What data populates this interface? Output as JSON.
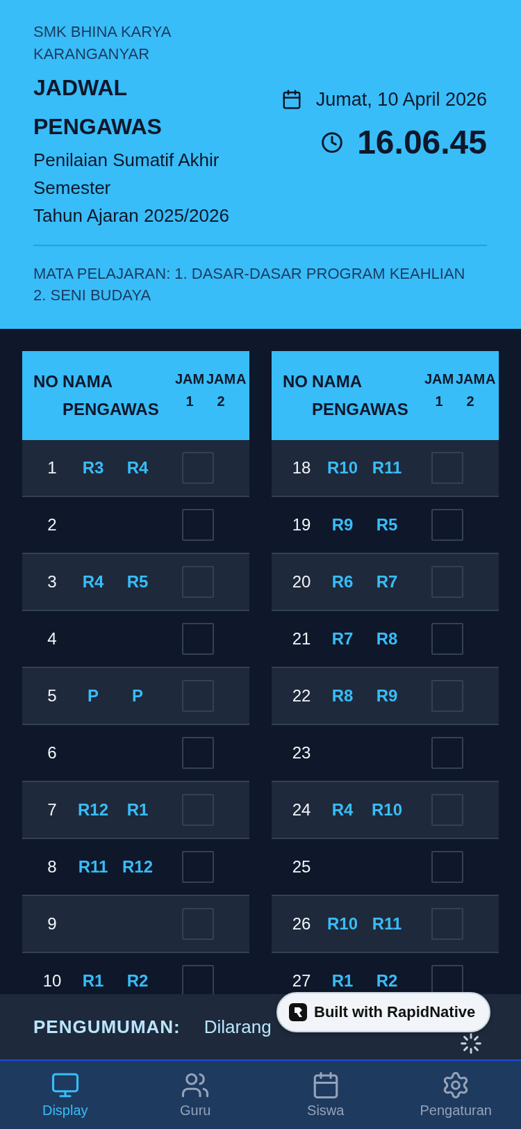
{
  "header": {
    "school": "SMK BHINA KARYA KARANGANYAR",
    "title": "JADWAL PENGAWAS",
    "subtitle": "Penilaian Sumatif Akhir Semester",
    "academic_year": "Tahun Ajaran 2025/2026",
    "date": "Jumat, 10 April 2026",
    "time": "16.06.45",
    "subjects": "MATA PELAJARAN: 1. DASAR-DASAR PROGRAM KEAHLIAN 2. SENI BUDAYA"
  },
  "tables": [
    {
      "columns": [
        "NO",
        "NAMA PENGAWAS",
        "JAM 1",
        "JAM 2",
        "A"
      ],
      "rows": [
        {
          "no": "1",
          "cells": [
            "R3",
            "R4"
          ],
          "checked": false
        },
        {
          "no": "2",
          "checked": false
        },
        {
          "no": "3",
          "cells": [
            "R4",
            "R5"
          ],
          "checked": false
        },
        {
          "no": "4",
          "checked": false
        },
        {
          "no": "5",
          "cells": [
            "P",
            "P"
          ],
          "checked": false
        },
        {
          "no": "6",
          "checked": false
        },
        {
          "no": "7",
          "cells": [
            "R12",
            "R1"
          ],
          "checked": false
        },
        {
          "no": "8",
          "cells": [
            "R11",
            "R12"
          ],
          "checked": false
        },
        {
          "no": "9",
          "checked": false
        },
        {
          "no": "10",
          "cells": [
            "R1",
            "R2"
          ],
          "checked": false
        }
      ]
    },
    {
      "columns": [
        "NO",
        "NAMA PENGAWAS",
        "JAM 1",
        "JAM 2",
        "A"
      ],
      "rows": [
        {
          "no": "18",
          "cells": [
            "R10",
            "R11"
          ],
          "checked": false
        },
        {
          "no": "19",
          "cells": [
            "R9",
            "R5"
          ],
          "checked": false
        },
        {
          "no": "20",
          "cells": [
            "R6",
            "R7"
          ],
          "checked": false
        },
        {
          "no": "21",
          "cells": [
            "R7",
            "R8"
          ],
          "checked": false
        },
        {
          "no": "22",
          "cells": [
            "R8",
            "R9"
          ],
          "checked": false
        },
        {
          "no": "23",
          "checked": false
        },
        {
          "no": "24",
          "cells": [
            "R4",
            "R10"
          ],
          "checked": false
        },
        {
          "no": "25",
          "checked": false
        },
        {
          "no": "26",
          "cells": [
            "R10",
            "R11"
          ],
          "checked": false
        },
        {
          "no": "27",
          "cells": [
            "R1",
            "R2"
          ],
          "checked": false
        }
      ]
    }
  ],
  "announcement": {
    "label": "PENGUMUMAN:",
    "text": "Dilarang"
  },
  "badge": {
    "label": "Built with RapidNative"
  },
  "nav": [
    {
      "label": "Display",
      "selected": true
    },
    {
      "label": "Guru",
      "selected": false
    },
    {
      "label": "Siswa",
      "selected": false
    },
    {
      "label": "Pengaturan",
      "selected": false
    }
  ]
}
